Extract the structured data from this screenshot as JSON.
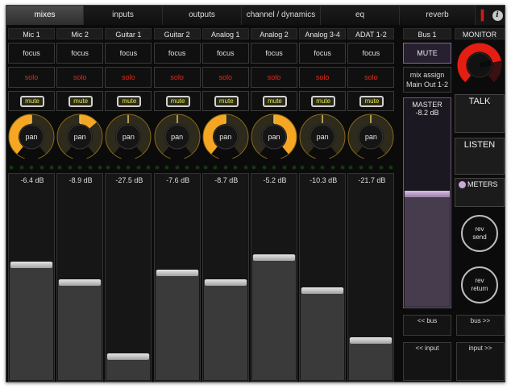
{
  "tabs": [
    {
      "label": "mixes",
      "active": true
    },
    {
      "label": "inputs",
      "active": false
    },
    {
      "label": "outputs",
      "active": false
    },
    {
      "label": "channel / dynamics",
      "active": false
    },
    {
      "label": "eq",
      "active": false
    },
    {
      "label": "reverb",
      "active": false
    }
  ],
  "info_button": "i",
  "colors": {
    "accent_orange": "#f5a623",
    "solo_red": "#e62a1a",
    "mute_yellow": "#e8e850",
    "master_purple": "#c9a7d6",
    "monitor_red": "#e41e12"
  },
  "channels": [
    {
      "name": "Mic 1",
      "focus": "focus",
      "solo": "solo",
      "mute": "mute",
      "pan_label": "pan",
      "pan": -1.0,
      "db": "-6.4 dB",
      "level": 0.58
    },
    {
      "name": "Mic 2",
      "focus": "focus",
      "solo": "solo",
      "mute": "mute",
      "pan_label": "pan",
      "pan": 0.35,
      "db": "-8.9 dB",
      "level": 0.49
    },
    {
      "name": "Guitar 1",
      "focus": "focus",
      "solo": "solo",
      "mute": "mute",
      "pan_label": "pan",
      "pan": 0.0,
      "db": "-27.5 dB",
      "level": 0.11
    },
    {
      "name": "Guitar 2",
      "focus": "focus",
      "solo": "solo",
      "mute": "mute",
      "pan_label": "pan",
      "pan": 0.0,
      "db": "-7.6 dB",
      "level": 0.54
    },
    {
      "name": "Analog 1",
      "focus": "focus",
      "solo": "solo",
      "mute": "mute",
      "pan_label": "pan",
      "pan": -1.0,
      "db": "-8.7 dB",
      "level": 0.49
    },
    {
      "name": "Analog 2",
      "focus": "focus",
      "solo": "solo",
      "mute": "mute",
      "pan_label": "pan",
      "pan": 1.0,
      "db": "-5.2 dB",
      "level": 0.62
    },
    {
      "name": "Analog 3-4",
      "focus": "focus",
      "solo": "solo",
      "mute": "mute",
      "pan_label": "pan",
      "pan": 0.0,
      "db": "-10.3 dB",
      "level": 0.45
    },
    {
      "name": "ADAT 1-2",
      "focus": "focus",
      "solo": "solo",
      "mute": "mute",
      "pan_label": "pan",
      "pan": 0.0,
      "db": "-21.7 dB",
      "level": 0.19
    }
  ],
  "bus": {
    "name": "Bus 1",
    "mute": "MUTE",
    "mix_assign_title": "mix assign",
    "mix_assign_value": "Main Out 1-2",
    "master_label": "MASTER",
    "master_db": "-8.2 dB",
    "master_level": 0.61,
    "prev_bus": "<< bus",
    "next_bus": "bus >>",
    "prev_input": "<< input",
    "next_input": "input >>"
  },
  "monitor": {
    "title": "MONITOR",
    "level": 0.78,
    "talk": "TALK",
    "listen": "LISTEN",
    "meters": "METERS",
    "rev_send_line1": "rev",
    "rev_send_line2": "send",
    "rev_return_line1": "rev",
    "rev_return_line2": "return"
  }
}
